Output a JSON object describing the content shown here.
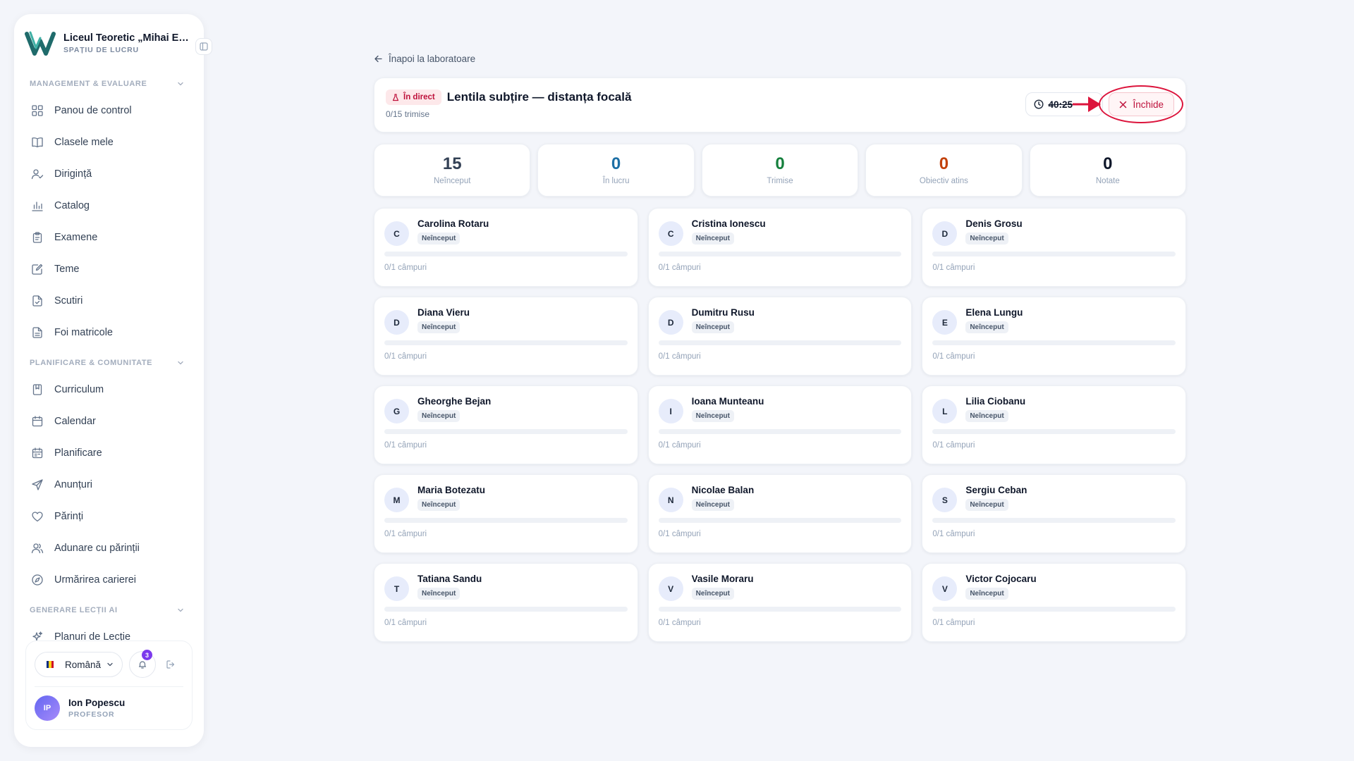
{
  "sidebar": {
    "school_name": "Liceul Teoretic „Mihai Eminescu”",
    "school_subtitle": "SPAȚIU DE LUCRU",
    "sections": [
      {
        "title": "MANAGEMENT & EVALUARE",
        "items": [
          {
            "label": "Panou de control",
            "icon": "dashboard-icon"
          },
          {
            "label": "Clasele mele",
            "icon": "book-open-icon"
          },
          {
            "label": "Dirigință",
            "icon": "user-check-icon"
          },
          {
            "label": "Catalog",
            "icon": "bar-chart-icon"
          },
          {
            "label": "Examene",
            "icon": "clipboard-icon"
          },
          {
            "label": "Teme",
            "icon": "edit-note-icon"
          },
          {
            "label": "Scutiri",
            "icon": "file-check-icon"
          },
          {
            "label": "Foi matricole",
            "icon": "file-text-icon"
          }
        ]
      },
      {
        "title": "PLANIFICARE & COMUNITATE",
        "items": [
          {
            "label": "Curriculum",
            "icon": "bookmark-book-icon"
          },
          {
            "label": "Calendar",
            "icon": "calendar-icon"
          },
          {
            "label": "Planificare",
            "icon": "calendar-list-icon"
          },
          {
            "label": "Anunțuri",
            "icon": "send-icon"
          },
          {
            "label": "Părinți",
            "icon": "heart-icon"
          },
          {
            "label": "Adunare cu părinții",
            "icon": "users-icon"
          },
          {
            "label": "Urmărirea carierei",
            "icon": "compass-icon"
          }
        ]
      },
      {
        "title": "GENERARE LECȚII AI",
        "items": [
          {
            "label": "Planuri de Lecție",
            "icon": "sparkles-icon"
          }
        ]
      }
    ],
    "language": "Română",
    "notifications_count": "3",
    "user": {
      "initials": "IP",
      "name": "Ion Popescu",
      "role": "PROFESOR"
    }
  },
  "main": {
    "back_label": "Înapoi la laboratoare",
    "live_label": "În direct",
    "title": "Lentila subțire — distanța focală",
    "submitted": "0/15 trimise",
    "timer": "40:25",
    "close_label": "Închide"
  },
  "stats": [
    {
      "value": "15",
      "label": "Neînceput",
      "color": "#334155"
    },
    {
      "value": "0",
      "label": "În lucru",
      "color": "#1d6fa5"
    },
    {
      "value": "0",
      "label": "Trimise",
      "color": "#15803d"
    },
    {
      "value": "0",
      "label": "Obiectiv atins",
      "color": "#c2410c"
    },
    {
      "value": "0",
      "label": "Notate",
      "color": "#0f172a"
    }
  ],
  "students": [
    {
      "initial": "C",
      "name": "Carolina Rotaru",
      "status": "Neînceput",
      "progress": 0,
      "fields": "0/1 câmpuri"
    },
    {
      "initial": "C",
      "name": "Cristina Ionescu",
      "status": "Neînceput",
      "progress": 0,
      "fields": "0/1 câmpuri"
    },
    {
      "initial": "D",
      "name": "Denis Grosu",
      "status": "Neînceput",
      "progress": 0,
      "fields": "0/1 câmpuri"
    },
    {
      "initial": "D",
      "name": "Diana Vieru",
      "status": "Neînceput",
      "progress": 0,
      "fields": "0/1 câmpuri"
    },
    {
      "initial": "D",
      "name": "Dumitru Rusu",
      "status": "Neînceput",
      "progress": 0,
      "fields": "0/1 câmpuri"
    },
    {
      "initial": "E",
      "name": "Elena Lungu",
      "status": "Neînceput",
      "progress": 0,
      "fields": "0/1 câmpuri"
    },
    {
      "initial": "G",
      "name": "Gheorghe Bejan",
      "status": "Neînceput",
      "progress": 0,
      "fields": "0/1 câmpuri"
    },
    {
      "initial": "I",
      "name": "Ioana Munteanu",
      "status": "Neînceput",
      "progress": 0,
      "fields": "0/1 câmpuri"
    },
    {
      "initial": "L",
      "name": "Lilia Ciobanu",
      "status": "Neînceput",
      "progress": 0,
      "fields": "0/1 câmpuri"
    },
    {
      "initial": "M",
      "name": "Maria Botezatu",
      "status": "Neînceput",
      "progress": 0,
      "fields": "0/1 câmpuri"
    },
    {
      "initial": "N",
      "name": "Nicolae Balan",
      "status": "Neînceput",
      "progress": 0,
      "fields": "0/1 câmpuri"
    },
    {
      "initial": "S",
      "name": "Sergiu Ceban",
      "status": "Neînceput",
      "progress": 0,
      "fields": "0/1 câmpuri"
    },
    {
      "initial": "T",
      "name": "Tatiana Sandu",
      "status": "Neînceput",
      "progress": 0,
      "fields": "0/1 câmpuri"
    },
    {
      "initial": "V",
      "name": "Vasile Moraru",
      "status": "Neînceput",
      "progress": 0,
      "fields": "0/1 câmpuri"
    },
    {
      "initial": "V",
      "name": "Victor Cojocaru",
      "status": "Neînceput",
      "progress": 0,
      "fields": "0/1 câmpuri"
    }
  ]
}
